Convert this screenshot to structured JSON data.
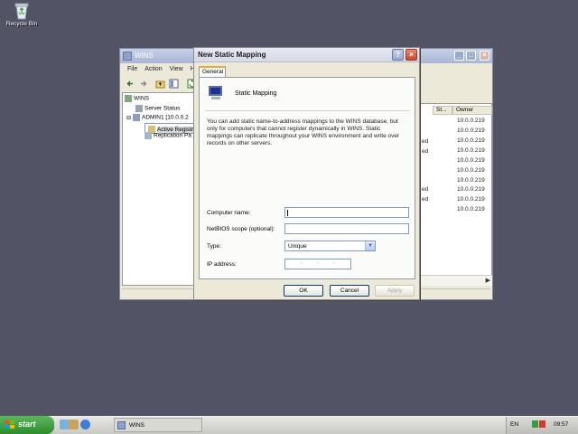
{
  "desktop": {
    "recycle_bin_label": "Recycle Bin"
  },
  "wins_window": {
    "title": "WINS",
    "menu": [
      "File",
      "Action",
      "View",
      "Help"
    ],
    "tree": [
      {
        "label": "WINS"
      },
      {
        "label": "Server Status"
      },
      {
        "label": "ADMIN1 [10.0.0.2"
      },
      {
        "label": "Active Registr"
      },
      {
        "label": "Replication Pa"
      }
    ],
    "columns": [
      "St...",
      "Owner"
    ],
    "status_fragments": [
      "ed",
      "ed",
      "ed",
      "ed"
    ],
    "owner_values": [
      "10.0.0.219",
      "10.0.0.219",
      "10.0.0.219",
      "10.0.0.219",
      "10.0.0.219",
      "10.0.0.219",
      "10.0.0.219",
      "10.0.0.219",
      "10.0.0.219",
      "10.0.0.219"
    ]
  },
  "dialog": {
    "title": "New Static Mapping",
    "help_glyph": "?",
    "close_glyph": "×",
    "tab": "General",
    "heading": "Static Mapping",
    "description": "You can add static name-to-address mappings to the WINS database, but only for computers that cannot register dynamically in WINS. Static mappings can replicate throughout your WINS environment and write over records on other servers.",
    "fields": {
      "computer_name_label": "Computer name:",
      "computer_name_value": "",
      "netbios_scope_label": "NetBIOS scope (optional):",
      "netbios_scope_value": "",
      "type_label": "Type:",
      "type_value": "Unique",
      "ip_label": "IP address:",
      "ip_dots": [
        "·",
        "·",
        "·"
      ]
    },
    "buttons": {
      "ok": "OK",
      "cancel": "Cancel",
      "apply": "Apply"
    }
  },
  "taskbar": {
    "start_label": "start",
    "task_wins_label": "WINS",
    "language": "EN",
    "clock": "09:57"
  }
}
